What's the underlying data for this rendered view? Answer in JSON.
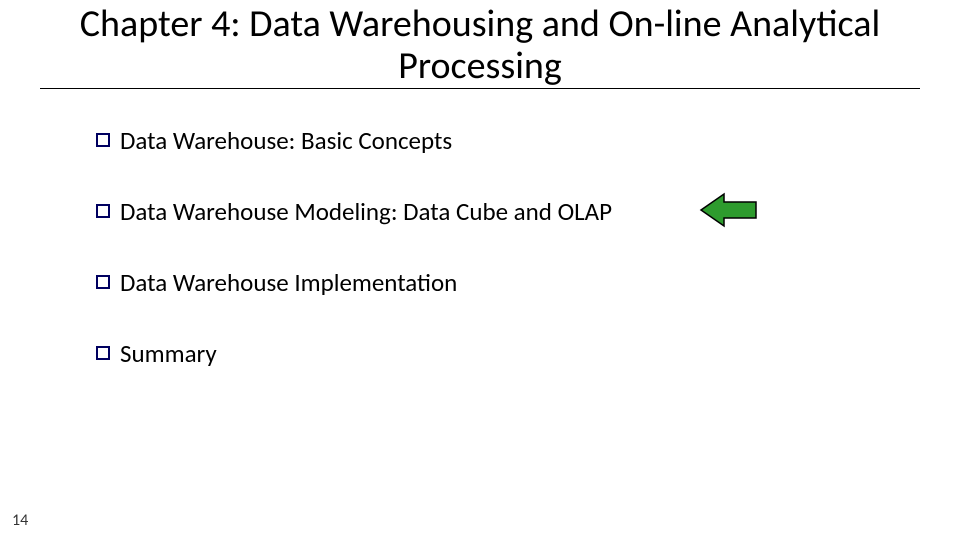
{
  "title": "Chapter 4: Data Warehousing and On-line Analytical Processing",
  "bullets": [
    {
      "label": "Data Warehouse: Basic Concepts",
      "highlighted": false
    },
    {
      "label": "Data Warehouse Modeling: Data Cube and OLAP",
      "highlighted": true
    },
    {
      "label": "Data Warehouse Implementation",
      "highlighted": false
    },
    {
      "label": "Summary",
      "highlighted": false
    }
  ],
  "page_number": "14",
  "colors": {
    "bullet_border": "#000060",
    "arrow_fill": "#2e9b2e",
    "arrow_stroke": "#000"
  }
}
